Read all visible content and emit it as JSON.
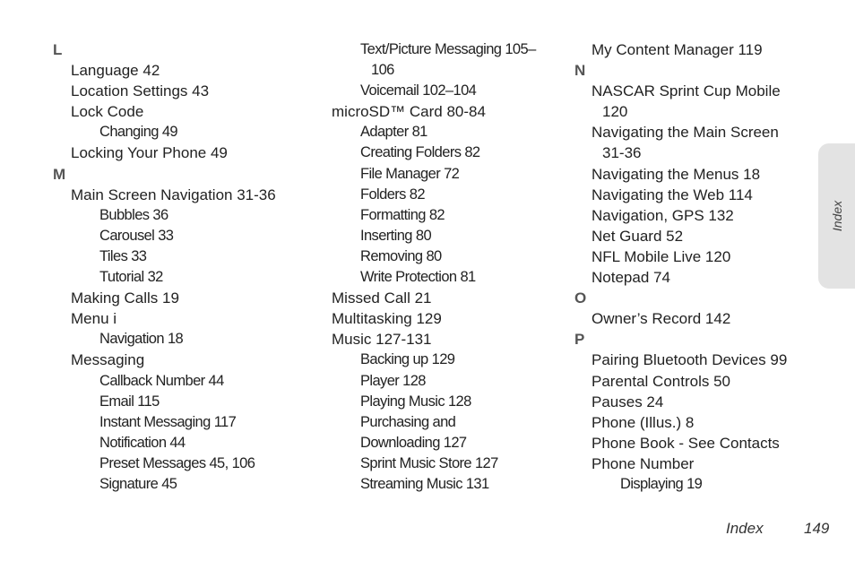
{
  "columns": [
    {
      "lines": [
        {
          "type": "letter",
          "text": "L"
        },
        {
          "type": "entry",
          "text": "Language 42"
        },
        {
          "type": "entry",
          "text": "Location Settings 43"
        },
        {
          "type": "entry",
          "text": "Lock Code"
        },
        {
          "type": "sub",
          "text": "Changing 49"
        },
        {
          "type": "entry",
          "text": "Locking Your Phone 49"
        },
        {
          "type": "letter",
          "text": "M"
        },
        {
          "type": "entry",
          "text": "Main Screen Navigation 31-36"
        },
        {
          "type": "sub",
          "text": "Bubbles 36"
        },
        {
          "type": "sub",
          "text": "Carousel 33"
        },
        {
          "type": "sub",
          "text": "Tiles 33"
        },
        {
          "type": "sub",
          "text": "Tutorial 32"
        },
        {
          "type": "entry",
          "text": "Making Calls 19"
        },
        {
          "type": "entry",
          "text": "Menu i"
        },
        {
          "type": "sub",
          "text": "Navigation 18"
        },
        {
          "type": "entry",
          "text": "Messaging"
        },
        {
          "type": "sub",
          "text": "Callback Number 44"
        },
        {
          "type": "sub",
          "text": "Email 115"
        },
        {
          "type": "sub",
          "text": "Instant Messaging 117"
        },
        {
          "type": "sub",
          "text": "Notification 44"
        },
        {
          "type": "sub",
          "text": "Preset Messages 45, 106"
        },
        {
          "type": "sub",
          "text": "Signature 45"
        }
      ]
    },
    {
      "lines": [
        {
          "type": "sub",
          "text": "Text/Picture Messaging 105–"
        },
        {
          "type": "subwrap",
          "text": "106"
        },
        {
          "type": "sub",
          "text": "Voicemail 102–104"
        },
        {
          "type": "entry",
          "text": "microSD™ Card 80-84"
        },
        {
          "type": "sub",
          "text": "Adapter 81"
        },
        {
          "type": "sub",
          "text": "Creating Folders 82"
        },
        {
          "type": "sub",
          "text": "File Manager 72"
        },
        {
          "type": "sub",
          "text": "Folders 82"
        },
        {
          "type": "sub",
          "text": "Formatting 82"
        },
        {
          "type": "sub",
          "text": "Inserting 80"
        },
        {
          "type": "sub",
          "text": "Removing 80"
        },
        {
          "type": "sub",
          "text": "Write Protection 81"
        },
        {
          "type": "entry",
          "text": "Missed Call 21"
        },
        {
          "type": "entry",
          "text": "Multitasking 129"
        },
        {
          "type": "entry",
          "text": "Music 127-131"
        },
        {
          "type": "sub",
          "text": "Backing up 129"
        },
        {
          "type": "sub",
          "text": "Player 128"
        },
        {
          "type": "sub",
          "text": "Playing Music 128"
        },
        {
          "type": "sub",
          "text": "Purchasing and"
        },
        {
          "type": "sub",
          "text": "Downloading 127"
        },
        {
          "type": "sub",
          "text": "Sprint Music Store 127"
        },
        {
          "type": "sub",
          "text": "Streaming Music 131"
        }
      ]
    },
    {
      "lines": [
        {
          "type": "entry",
          "text": "My Content Manager 119"
        },
        {
          "type": "letter",
          "text": "N"
        },
        {
          "type": "entry",
          "text": "NASCAR Sprint Cup Mobile"
        },
        {
          "type": "cont",
          "text": "120"
        },
        {
          "type": "entry",
          "text": "Navigating the Main Screen"
        },
        {
          "type": "cont",
          "text": "31-36"
        },
        {
          "type": "entry",
          "text": "Navigating the Menus 18"
        },
        {
          "type": "entry",
          "text": "Navigating the Web 114"
        },
        {
          "type": "entry",
          "text": "Navigation, GPS 132"
        },
        {
          "type": "entry",
          "text": "Net Guard 52"
        },
        {
          "type": "entry",
          "text": "NFL Mobile Live 120"
        },
        {
          "type": "entry",
          "text": "Notepad 74"
        },
        {
          "type": "letter",
          "text": "O"
        },
        {
          "type": "entry",
          "text": "Owner’s Record 142"
        },
        {
          "type": "letter",
          "text": "P"
        },
        {
          "type": "entry",
          "text": "Pairing Bluetooth Devices 99"
        },
        {
          "type": "entry",
          "text": "Parental Controls 50"
        },
        {
          "type": "entry",
          "text": "Pauses 24"
        },
        {
          "type": "entry",
          "text": "Phone (Illus.) 8"
        },
        {
          "type": "entry",
          "text": "Phone Book - See Contacts"
        },
        {
          "type": "entry",
          "text": "Phone Number"
        },
        {
          "type": "sub",
          "text": "Displaying 19"
        }
      ]
    }
  ],
  "side_tab": {
    "label": "Index"
  },
  "footer": {
    "section": "Index",
    "page_number": "149"
  }
}
